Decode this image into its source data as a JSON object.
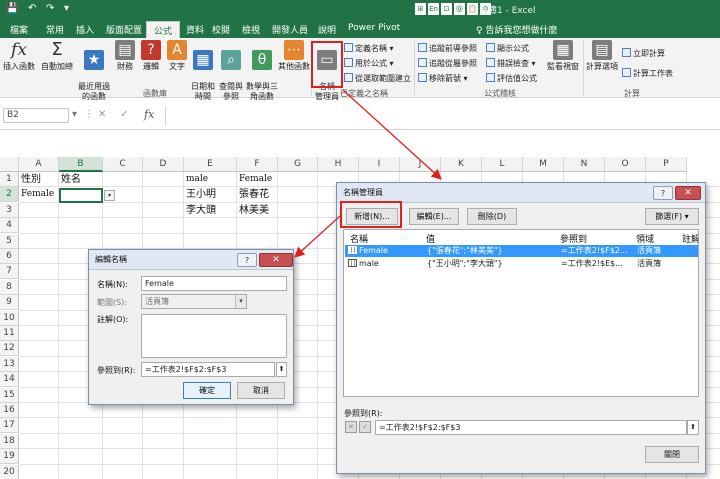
{
  "titlebar": {
    "title": "活頁簿1 - Excel",
    "quick_access": [
      "💾",
      "↶",
      "↷",
      "▾"
    ],
    "ime_icons": [
      "⊞",
      "En",
      "⊡",
      "@",
      "📋",
      "⚙"
    ]
  },
  "tabs": [
    "檔案",
    "常用",
    "插入",
    "版面配置",
    "公式",
    "資料",
    "校閱",
    "檢視",
    "開發人員",
    "說明",
    "Power Pivot"
  ],
  "active_tab": "公式",
  "tell_me": "♀ 告訴我您想做什麼",
  "ribbon": {
    "function_library": {
      "buttons": [
        {
          "label": "插入函數",
          "icon": "fx"
        },
        {
          "label": "自動加總",
          "icon": "Σ"
        },
        {
          "label": "最近用過\n的函數",
          "icon": "★"
        },
        {
          "label": "財務",
          "icon": "▤"
        },
        {
          "label": "邏輯",
          "icon": "?"
        },
        {
          "label": "文字",
          "icon": "A"
        },
        {
          "label": "日期和\n時間",
          "icon": "▦"
        },
        {
          "label": "查閱與\n參照",
          "icon": "⌕"
        },
        {
          "label": "數學與三\n角函數",
          "icon": "θ"
        },
        {
          "label": "其他函數",
          "icon": "⋯"
        }
      ],
      "group_label": "函數庫"
    },
    "defined_names": {
      "name_manager": "名稱\n管理員",
      "commands": [
        "定義名稱 ▾",
        "用於公式 ▾",
        "從選取範圍建立"
      ],
      "group_label": "已定義之名稱"
    },
    "formula_auditing": {
      "commands": [
        "追蹤前導參照",
        "顯示公式",
        "追蹤從屬參照",
        "錯誤檢查 ▾",
        "移除箭號 ▾",
        "評估值公式"
      ],
      "watch_window": "監看視窗",
      "group_label": "公式稽核"
    },
    "calculation": {
      "options": "計算選項",
      "commands": [
        "立即計算",
        "計算工作表"
      ],
      "group_label": "計算"
    }
  },
  "formula_bar": {
    "name_box": "B2",
    "icons": [
      "⋮",
      "✕",
      "✓",
      "fx"
    ],
    "content": ""
  },
  "sheet": {
    "columns": [
      "A",
      "B",
      "C",
      "D",
      "E",
      "F",
      "G",
      "H",
      "I",
      "J",
      "K",
      "L",
      "M",
      "N",
      "O",
      "P"
    ],
    "selected_column": "B",
    "rows": [
      "1",
      "2",
      "3",
      "4",
      "5",
      "6",
      "7",
      "8",
      "9",
      "10",
      "11",
      "12",
      "13",
      "14",
      "15",
      "16",
      "17",
      "18",
      "19",
      "20"
    ],
    "selected_row": "2",
    "cells": {
      "A1": "性別",
      "B1": "姓名",
      "A2": "Female",
      "E1": "male",
      "E2": "王小明",
      "E3": "李大頭",
      "F1": "Female",
      "F2": "張春花",
      "F3": "林美美"
    },
    "dropdown_arrow": "▾"
  },
  "edit_name_dialog": {
    "title": "編輯名稱",
    "help": "?",
    "close": "✕",
    "name_label": "名稱(N):",
    "name_value": "Female",
    "scope_label": "範圍(S):",
    "scope_value": "活頁簿",
    "comment_label": "註解(O):",
    "refers_label": "參照到(R):",
    "refers_value": "=工作表2!$F$2:$F$3",
    "ok": "確定",
    "cancel": "取消",
    "dropdown_arrow": "▾",
    "collapse_icon": "⬆"
  },
  "name_manager_dialog": {
    "title": "名稱管理員",
    "help": "?",
    "close": "✕",
    "new": "新增(N)...",
    "edit": "編輯(E)...",
    "delete": "刪除(D)",
    "filter": "篩選(F) ▾",
    "columns": [
      "名稱",
      "值",
      "參照到",
      "領域",
      "註解"
    ],
    "rows": [
      {
        "name": "Female",
        "value": "{\"張春花\";\"林美美\"}",
        "refers": "=工作表2!$F$2...",
        "scope": "活頁簿",
        "selected": true
      },
      {
        "name": "male",
        "value": "{\"王小明\";\"李大頭\"}",
        "refers": "=工作表2!$E$...",
        "scope": "活頁簿",
        "selected": false
      }
    ],
    "refers_label": "參照到(R):",
    "refers_value": "=工作表2!$F$2:$F$3",
    "close_button": "關閉",
    "cancel_icon": "✕",
    "confirm_icon": "✓",
    "collapse_icon": "⬆"
  },
  "colors": {
    "excel_green": "#217346",
    "annotation_red": "#e02020",
    "selection_blue": "#3399ff"
  }
}
